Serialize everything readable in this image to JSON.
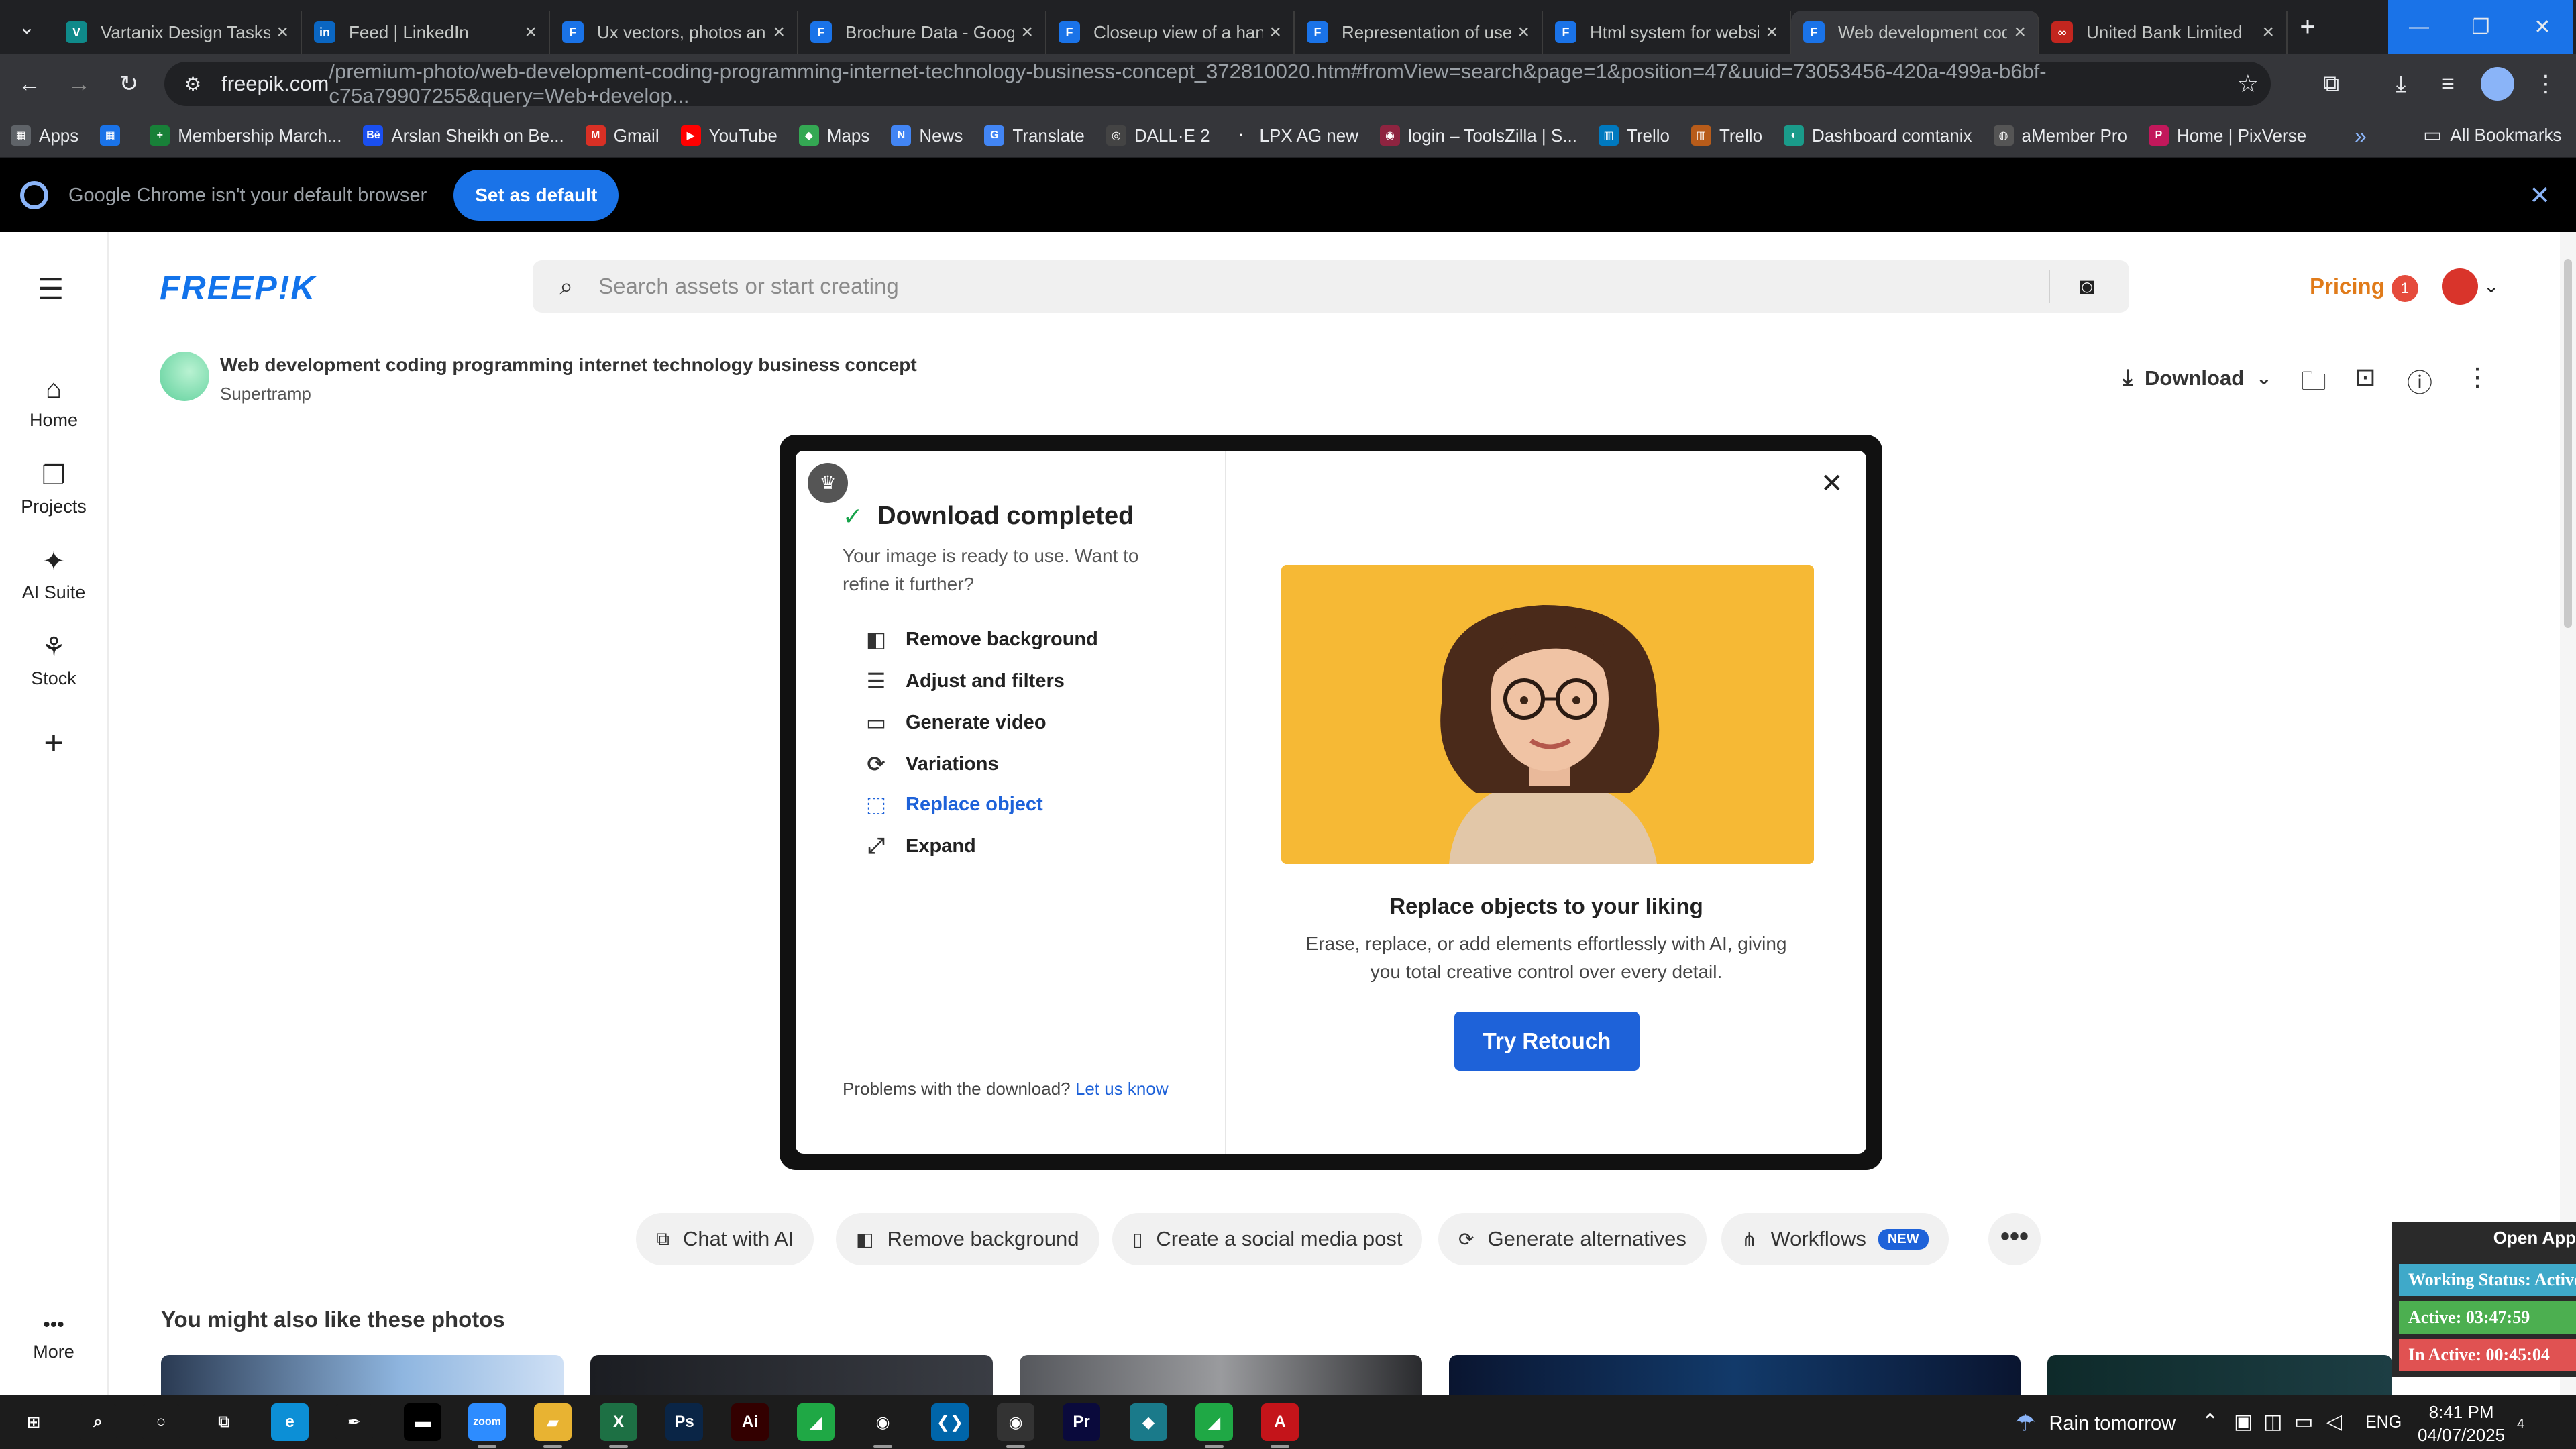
{
  "browser": {
    "tabs": [
      {
        "title": "Vartanix Design Tasks",
        "favicon": "V",
        "color": "#0f8a8a"
      },
      {
        "title": "Feed | LinkedIn",
        "favicon": "in",
        "color": "#0a66c2"
      },
      {
        "title": "Ux vectors, photos and...",
        "favicon": "F",
        "color": "#1a73e8"
      },
      {
        "title": "Brochure Data - Google...",
        "favicon": "F",
        "color": "#1a73e8"
      },
      {
        "title": "Closeup view of a hand...",
        "favicon": "F",
        "color": "#1a73e8"
      },
      {
        "title": "Representation of user...",
        "favicon": "F",
        "color": "#1a73e8"
      },
      {
        "title": "Html system for websites",
        "favicon": "F",
        "color": "#1a73e8"
      },
      {
        "title": "Web development coding...",
        "favicon": "F",
        "color": "#1a73e8"
      },
      {
        "title": "United Bank Limited",
        "favicon": "∞",
        "color": "#c3261f"
      }
    ],
    "new_tab": "+",
    "window_controls": {
      "minimize": "—",
      "maximize": "❐",
      "close": "✕"
    },
    "url_domain": "freepik.com",
    "url_path": "/premium-photo/web-development-coding-programming-internet-technology-business-concept_372810020.htm#fromView=search&page=1&position=47&uuid=73053456-420a-499a-b6bf-c75a79907255&query=Web+develop...",
    "bookmarks": [
      {
        "label": "Apps",
        "icon": "▦",
        "color": "#5f6368"
      },
      {
        "label": "",
        "icon": "▦",
        "color": "#1a73e8"
      },
      {
        "label": "Membership March...",
        "icon": "+",
        "color": "#188038"
      },
      {
        "label": "Arslan Sheikh on Be...",
        "icon": "Bē",
        "color": "#1a4ff0"
      },
      {
        "label": "Gmail",
        "icon": "M",
        "color": "#d93025"
      },
      {
        "label": "YouTube",
        "icon": "▶",
        "color": "#ff0000"
      },
      {
        "label": "Maps",
        "icon": "◆",
        "color": "#34a853"
      },
      {
        "label": "News",
        "icon": "N",
        "color": "#4285f4"
      },
      {
        "label": "Translate",
        "icon": "G",
        "color": "#4285f4"
      },
      {
        "label": "DALL·E 2",
        "icon": "◎",
        "color": "#444"
      },
      {
        "label": "LPX AG new",
        "icon": "·",
        "color": "#35363a"
      },
      {
        "label": "login – ToolsZilla | S...",
        "icon": "◉",
        "color": "#8e2440"
      },
      {
        "label": "Trello",
        "icon": "▥",
        "color": "#0079bf"
      },
      {
        "label": "Trello",
        "icon": "▥",
        "color": "#b85c1a"
      },
      {
        "label": "Dashboard comtanix",
        "icon": "◐",
        "color": "#1a9b8a"
      },
      {
        "label": "aMember Pro",
        "icon": "◍",
        "color": "#555"
      },
      {
        "label": "Home | PixVerse",
        "icon": "P",
        "color": "#c2185b"
      }
    ],
    "bookmarks_more": "»",
    "all_bookmarks": "All Bookmarks"
  },
  "infobar": {
    "message": "Google Chrome isn't your default browser",
    "button": "Set as default"
  },
  "rail": {
    "items": [
      {
        "label": "Home",
        "icon": "⌂"
      },
      {
        "label": "Projects",
        "icon": "❐"
      },
      {
        "label": "AI Suite",
        "icon": "✦"
      },
      {
        "label": "Stock",
        "icon": "⚘"
      }
    ],
    "add": "+",
    "more_label": "More",
    "more_icon": "•••"
  },
  "header": {
    "logo": "FREEP!K",
    "search_placeholder": "Search assets or start creating",
    "pricing": "Pricing",
    "notification_count": "1"
  },
  "asset": {
    "title": "Web development coding programming internet technology business concept",
    "author": "Supertramp",
    "download_label": "Download"
  },
  "modal": {
    "heading": "Download completed",
    "description": "Your image is ready to use. Want to refine it further?",
    "options": [
      {
        "label": "Remove background",
        "icon": "◧"
      },
      {
        "label": "Adjust and filters",
        "icon": "☰"
      },
      {
        "label": "Generate video",
        "icon": "▭"
      },
      {
        "label": "Variations",
        "icon": "⟳"
      },
      {
        "label": "Replace object",
        "icon": "⬚"
      },
      {
        "label": "Expand",
        "icon": "⤢"
      }
    ],
    "selected_option": "Replace object",
    "problems_text": "Problems with the download?",
    "problems_link": "Let us know",
    "promo_title": "Replace objects to your liking",
    "promo_desc": "Erase, replace, or add elements effortlessly with AI, giving you total creative control over every detail.",
    "promo_button": "Try Retouch"
  },
  "chips": [
    {
      "label": "Chat with AI",
      "icon": "⧉"
    },
    {
      "label": "Remove background",
      "icon": "◧"
    },
    {
      "label": "Create a social media post",
      "icon": "▯"
    },
    {
      "label": "Generate alternatives",
      "icon": "⟳"
    },
    {
      "label": "Workflows",
      "icon": "⋔",
      "badge": "NEW"
    }
  ],
  "more_chip": "•••",
  "related_heading": "You might also like these photos",
  "tracker": {
    "open_label": "Open App",
    "status": "Working Status: Active",
    "active": "Active: 03:47:59",
    "inactive": "In Active: 00:45:04"
  },
  "taskbar": {
    "weather": "Rain tomorrow",
    "language": "ENG",
    "time": "8:41 PM",
    "date": "04/07/2025",
    "notifications": "4",
    "apps": [
      {
        "name": "start",
        "glyph": "⊞",
        "color": "#1c1c1c"
      },
      {
        "name": "search",
        "glyph": "⌕",
        "color": "#1c1c1c"
      },
      {
        "name": "cortana",
        "glyph": "○",
        "color": "#1c1c1c"
      },
      {
        "name": "task-view",
        "glyph": "⧉",
        "color": "#1c1c1c"
      },
      {
        "name": "edge",
        "glyph": "e",
        "color": "#0c8fd6"
      },
      {
        "name": "pen",
        "glyph": "✒",
        "color": "#1c1c1c"
      },
      {
        "name": "terminal",
        "glyph": "▬",
        "color": "#000"
      },
      {
        "name": "zoom",
        "glyph": "zoom",
        "color": "#2d8cff"
      },
      {
        "name": "file-explorer",
        "glyph": "▰",
        "color": "#e8b332"
      },
      {
        "name": "excel",
        "glyph": "X",
        "color": "#1d7044"
      },
      {
        "name": "photoshop",
        "glyph": "Ps",
        "color": "#0a2546"
      },
      {
        "name": "illustrator",
        "glyph": "Ai",
        "color": "#330000"
      },
      {
        "name": "app-green",
        "glyph": "◢",
        "color": "#1fa845"
      },
      {
        "name": "chrome",
        "glyph": "◉",
        "color": "#1c1c1c"
      },
      {
        "name": "vscode",
        "glyph": "❮❯",
        "color": "#0065a9"
      },
      {
        "name": "chrome-active",
        "glyph": "◉",
        "color": "#333"
      },
      {
        "name": "premiere",
        "glyph": "Pr",
        "color": "#0a0a3c"
      },
      {
        "name": "app-teal",
        "glyph": "◆",
        "color": "#1a7a8a"
      },
      {
        "name": "app-green-2",
        "glyph": "◢",
        "color": "#1fa845"
      },
      {
        "name": "acrobat",
        "glyph": "A",
        "color": "#c4141a"
      }
    ]
  },
  "colors": {
    "brand_blue": "#1e62d9",
    "pricing_orange": "#e07b1a",
    "tracker_status": "#3fa9c9",
    "tracker_active": "#4caf50",
    "tracker_inactive": "#e05252"
  }
}
